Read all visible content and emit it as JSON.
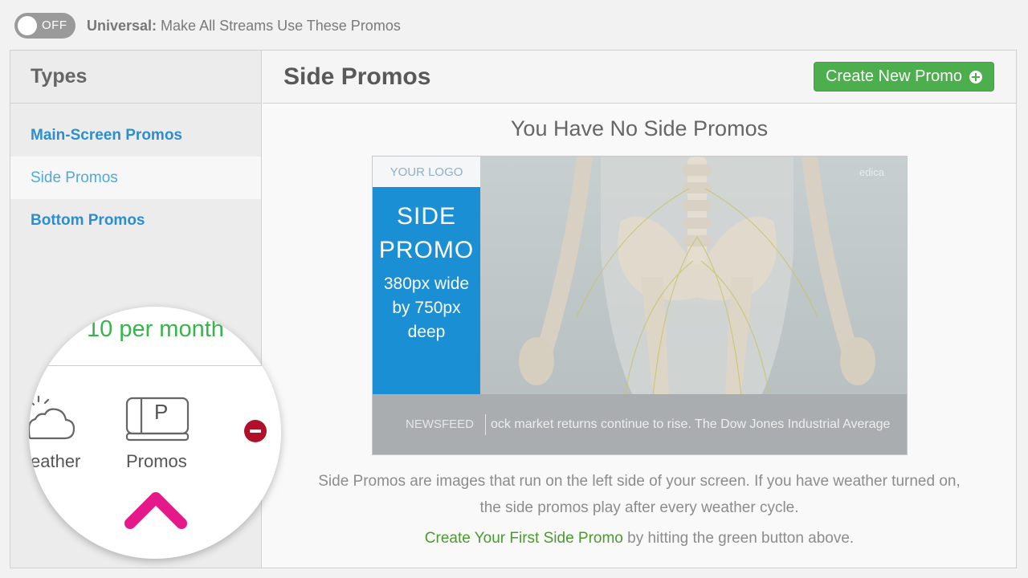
{
  "toggle": {
    "state_label": "OFF"
  },
  "universal": {
    "bold": "Universal:",
    "text": " Make All Streams Use These Promos"
  },
  "sidebar": {
    "title": "Types",
    "items": [
      {
        "label": "Main-Screen Promos"
      },
      {
        "label": "Side Promos"
      },
      {
        "label": "Bottom Promos"
      }
    ]
  },
  "main": {
    "title": "Side Promos",
    "create_button": "Create New Promo",
    "empty_heading": "You Have No Side Promos"
  },
  "preview": {
    "logo": "YOUR LOGO",
    "promo_line1": "SIDE",
    "promo_line2": "PROMO",
    "size_line1": "380px wide",
    "size_line2": "by 750px",
    "size_line3": "deep",
    "newsfeed_label": "NEWSFEED",
    "newsfeed_text": "ock market returns continue to rise. The Dow Jones Industrial Average",
    "watermark": "edica"
  },
  "description": {
    "line1": "Side Promos are images that run on the left side of your screen. If you have weather turned on,",
    "line2": "the side promos play after every weather cycle."
  },
  "cta": {
    "link": "Create Your First Side Promo",
    "rest": " by hitting the green button above."
  },
  "magnifier": {
    "price": "10 per month",
    "weather_label": "eather",
    "promos_label": "Promos",
    "promos_icon_letter": "P"
  },
  "colors": {
    "accent_green": "#4cae4c",
    "link_blue": "#2b8fcf",
    "promo_blue": "#1b8fd3",
    "arrow_magenta": "#e5198a",
    "remove_red": "#b0102a"
  }
}
